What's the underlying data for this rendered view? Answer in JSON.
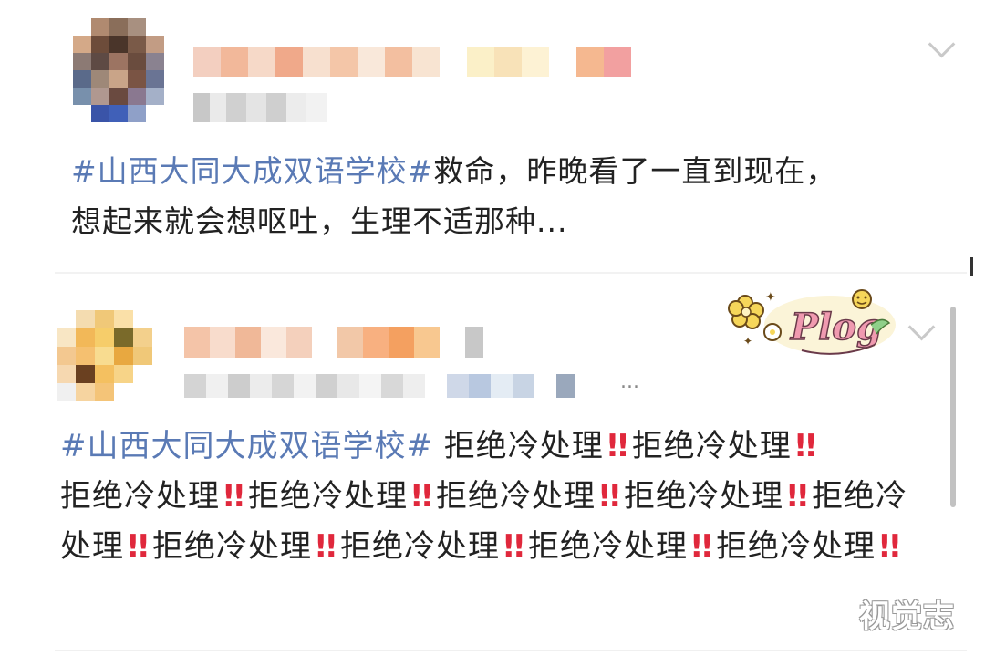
{
  "post1": {
    "hashtag": "#山西大同大成双语学校#",
    "line1_rest": "救命，昨晚看了一直到现在，",
    "line2": "想起来就会想呕吐，生理不适那种..."
  },
  "post2": {
    "hashtag": "#山西大同大成双语学校#",
    "phrase": "拒绝冷处理",
    "emoji": "!!",
    "meta_suffix": "..."
  },
  "sticker": {
    "text": "Plog"
  },
  "watermark": {
    "text": "视觉志"
  },
  "colors": {
    "hashtag": "#5a7ab5",
    "bang": "#e0283c",
    "text": "#222222"
  }
}
